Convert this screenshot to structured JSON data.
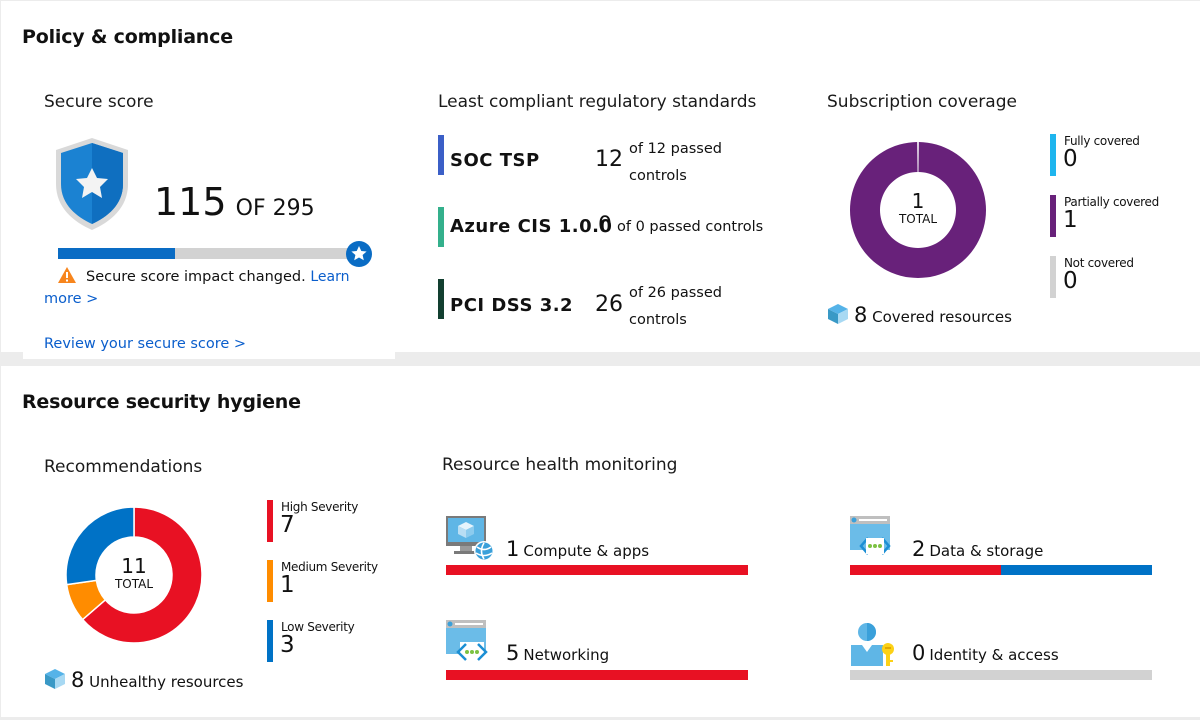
{
  "policy": {
    "title": "Policy & compliance",
    "secure_score": {
      "title": "Secure score",
      "score": "115",
      "of_label": "OF 295",
      "current": 115,
      "max": 295,
      "warning_text": "Secure score impact changed.",
      "learn_more": "Learn more >",
      "learn_more_1": "Learn",
      "learn_more_2": "more >",
      "review_link": "Review your secure score >"
    },
    "standards": {
      "title": "Least compliant regulatory standards",
      "items": [
        {
          "name": "SOC TSP",
          "passed": "12",
          "text_1": "of 12 passed",
          "text_2": "controls",
          "color": "#3b5fc7"
        },
        {
          "name": "Azure CIS 1.0.0",
          "passed": "0",
          "text_1": "of 0 passed controls",
          "text_2": "",
          "color": "#34b08c"
        },
        {
          "name": "PCI DSS 3.2",
          "passed": "26",
          "text_1": "of 26 passed",
          "text_2": "controls",
          "color": "#123f30"
        }
      ]
    },
    "coverage": {
      "title": "Subscription coverage",
      "total": "1",
      "total_label": "TOTAL",
      "legend": [
        {
          "label": "Fully covered",
          "value": "0",
          "count": 0,
          "color": "#1eb5ee"
        },
        {
          "label": "Partially covered",
          "value": "1",
          "count": 1,
          "color": "#68217a"
        },
        {
          "label": "Not covered",
          "value": "0",
          "count": 0,
          "color": "#d2d2d2"
        }
      ],
      "covered_resources_count": "8",
      "covered_resources_label": "Covered resources"
    }
  },
  "hygiene": {
    "title": "Resource security hygiene",
    "recommendations": {
      "title": "Recommendations",
      "total": "11",
      "total_label": "TOTAL",
      "legend": [
        {
          "label": "High Severity",
          "value": "7",
          "count": 7,
          "color": "#e81123"
        },
        {
          "label": "Medium Severity",
          "value": "1",
          "count": 1,
          "color": "#ff8c00"
        },
        {
          "label": "Low Severity",
          "value": "3",
          "count": 3,
          "color": "#0072c6"
        }
      ],
      "unhealthy_count": "8",
      "unhealthy_label": "Unhealthy resources"
    },
    "health": {
      "title": "Resource health monitoring",
      "items": [
        {
          "count": "1",
          "label": "Compute & apps",
          "icon": "compute-icon",
          "segments": [
            {
              "fraction": 1.0,
              "color": "#e81123"
            }
          ]
        },
        {
          "count": "2",
          "label": "Data & storage",
          "icon": "data-storage-icon",
          "segments": [
            {
              "fraction": 0.5,
              "color": "#e81123"
            },
            {
              "fraction": 0.5,
              "color": "#0072c6"
            }
          ]
        },
        {
          "count": "5",
          "label": "Networking",
          "icon": "networking-icon",
          "segments": [
            {
              "fraction": 1.0,
              "color": "#e81123"
            }
          ]
        },
        {
          "count": "0",
          "label": "Identity & access",
          "icon": "identity-access-icon",
          "segments": [
            {
              "fraction": 1.0,
              "color": "#d2d2d2"
            }
          ]
        }
      ]
    }
  }
}
